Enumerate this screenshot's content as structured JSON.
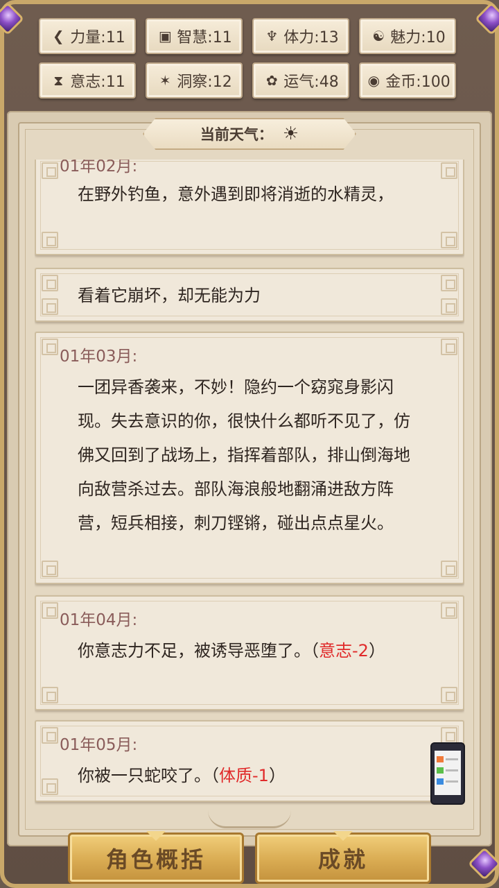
{
  "stats": [
    {
      "icon": "fist-icon",
      "glyph": "❮",
      "label": "力量:11"
    },
    {
      "icon": "book-icon",
      "glyph": "▣",
      "label": "智慧:11"
    },
    {
      "icon": "person-icon",
      "glyph": "♆",
      "label": "体力:13"
    },
    {
      "icon": "charm-icon",
      "glyph": "☯",
      "label": "魅力:10"
    },
    {
      "icon": "hourglass-icon",
      "glyph": "⧗",
      "label": "意志:11"
    },
    {
      "icon": "eagle-icon",
      "glyph": "✶",
      "label": "洞察:12"
    },
    {
      "icon": "clover-icon",
      "glyph": "✿",
      "label": "运气:48"
    },
    {
      "icon": "coin-icon",
      "glyph": "◉",
      "label": "金币:100"
    }
  ],
  "weather": {
    "label": "当前天气：",
    "icon": "sun-icon",
    "glyph": "☀"
  },
  "entries": [
    {
      "date": "01年02月:",
      "text": "在野外钓鱼，意外遇到即将消逝的水精灵，"
    },
    {
      "date": "",
      "text": "看着它崩坏，却无能为力"
    },
    {
      "date": "01年03月:",
      "text": "一团异香袭来，不妙！隐约一个窈窕身影闪现。失去意识的你，很快什么都听不见了，仿佛又回到了战场上，指挥着部队，排山倒海地向敌营杀过去。部队海浪般地翻涌进敌方阵营，短兵相接，刺刀铿锵，碰出点点星火。"
    },
    {
      "date": "01年04月:",
      "text_before": "你意志力不足，被诱导恶堕了。（",
      "text_red": "意志-2",
      "text_after": "）"
    },
    {
      "date": "01年05月:",
      "text_before": "你被一只蛇咬了。（",
      "text_red": "体质-1",
      "text_after": "）"
    }
  ],
  "buttons": {
    "summary": "角色概括",
    "achievements": "成就"
  },
  "colors": {
    "accent_red": "#e02a2a",
    "date_color": "#8a5c5a",
    "button_gold": "#d9ab52"
  }
}
